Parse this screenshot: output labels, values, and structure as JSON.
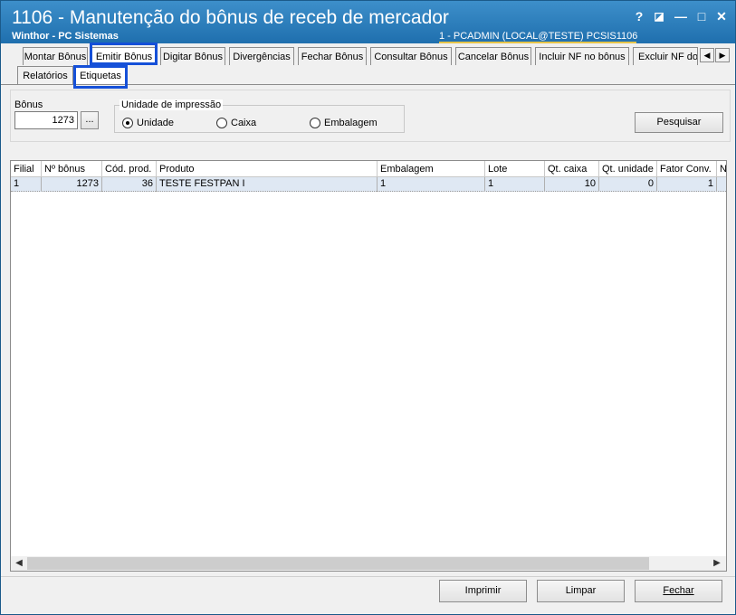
{
  "window": {
    "title": "1106 - Manutenção do bônus de receb de mercador",
    "subtitle": "Winthor - PC Sistemas",
    "session": "1 - PCADMIN (LOCAL@TESTE)   PCSIS1106",
    "help_label": "?",
    "restore_label": "◪",
    "minimize_label": "—",
    "maximize_label": "□",
    "close_label": "✕"
  },
  "tabs": [
    {
      "label": "Montar Bônus"
    },
    {
      "label": "Emitir Bônus"
    },
    {
      "label": "Digitar Bônus"
    },
    {
      "label": "Divergências"
    },
    {
      "label": "Fechar Bônus"
    },
    {
      "label": "Consultar Bônus"
    },
    {
      "label": "Cancelar Bônus"
    },
    {
      "label": "Incluir NF no bônus"
    },
    {
      "label": "Excluir NF do bônus"
    }
  ],
  "subtabs": [
    {
      "label": "Relatórios"
    },
    {
      "label": "Etiquetas"
    }
  ],
  "form": {
    "bonus_label": "Bônus",
    "bonus_value": "1273",
    "lookup_label": "...",
    "unidade_group_label": "Unidade de impressão",
    "radio_options": [
      {
        "label": "Unidade",
        "checked": true
      },
      {
        "label": "Caixa",
        "checked": false
      },
      {
        "label": "Embalagem",
        "checked": false
      }
    ],
    "search_button": "Pesquisar"
  },
  "grid": {
    "columns": [
      "Filial",
      "Nº bônus",
      "Cód. prod.",
      "Produto",
      "Embalagem",
      "Lote",
      "Qt. caixa",
      "Qt. unidade",
      "Fator Conv.",
      "N"
    ],
    "rows": [
      [
        "1",
        "1273",
        "36",
        "TESTE FESTPAN I",
        "1",
        "1",
        "10",
        "0",
        "1",
        ""
      ]
    ]
  },
  "buttons": {
    "print": "Imprimir",
    "clear": "Limpar",
    "close": "Fechar"
  },
  "colors": {
    "titlebar": "#2a7cbc",
    "highlight": "#1550d8",
    "selected_row": "#dfe8f3"
  }
}
